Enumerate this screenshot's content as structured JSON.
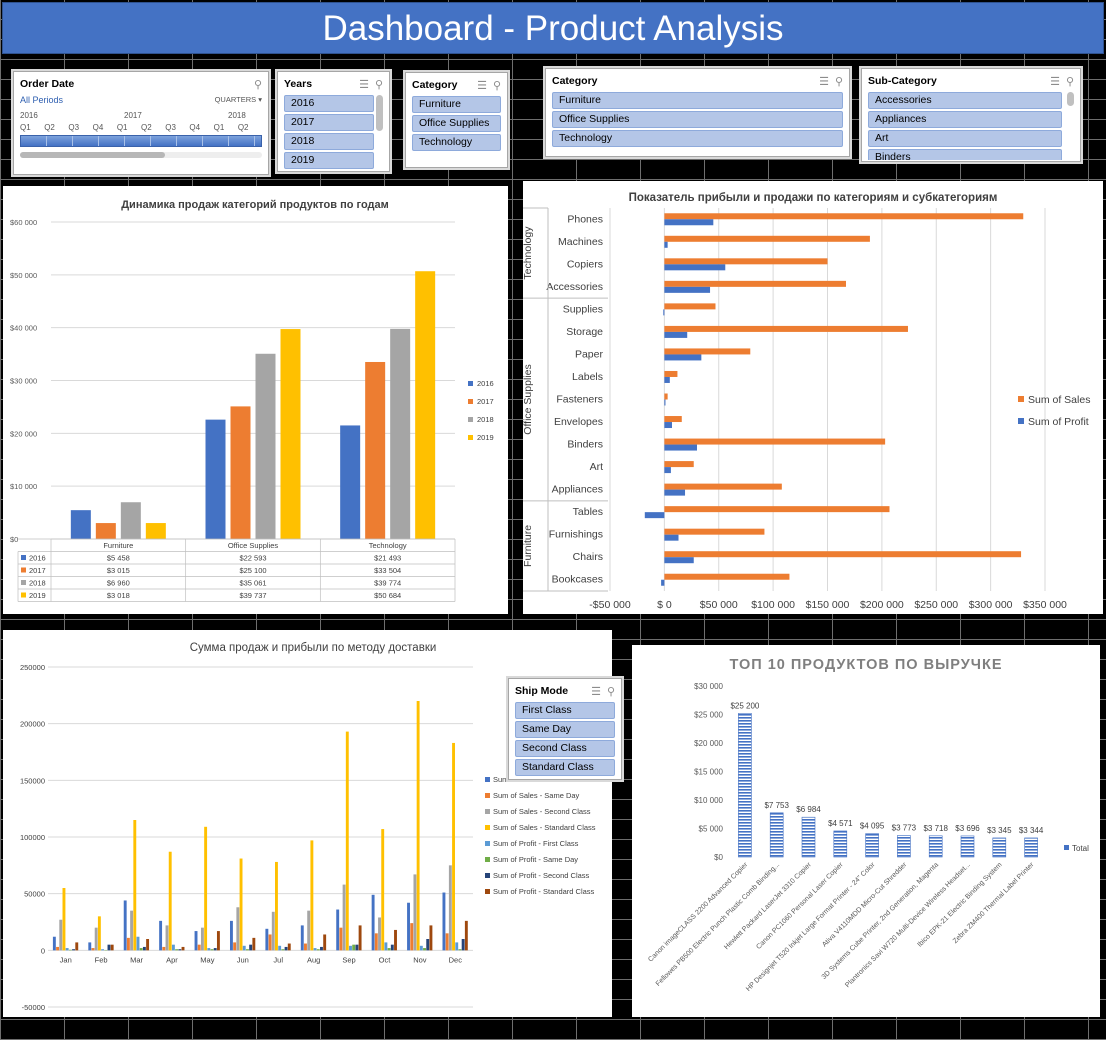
{
  "header": {
    "title": "Dashboard - Product Analysis"
  },
  "colors": {
    "accent": "#4472c4",
    "c2016": "#4472c4",
    "c2017": "#ed7d31",
    "c2018": "#a5a5a5",
    "c2019": "#ffc000",
    "sales": "#ed7d31",
    "profit": "#4472c4"
  },
  "icons": {
    "multiselect": "multiselect-icon",
    "clear_filter": "clear-filter-icon"
  },
  "slicers": {
    "order_date": {
      "title": "Order Date",
      "all_periods": "All Periods",
      "level": "QUARTERS",
      "years": [
        "2016",
        "2017",
        "2018"
      ],
      "quarters": [
        "Q1",
        "Q2",
        "Q3",
        "Q4",
        "Q1",
        "Q2",
        "Q3",
        "Q4",
        "Q1",
        "Q2"
      ]
    },
    "years": {
      "title": "Years",
      "items": [
        "2016",
        "2017",
        "2018",
        "2019"
      ]
    },
    "category_small": {
      "title": "Category",
      "items": [
        "Furniture",
        "Office Supplies",
        "Technology"
      ]
    },
    "category": {
      "title": "Category",
      "items": [
        "Furniture",
        "Office Supplies",
        "Technology"
      ]
    },
    "subcategory": {
      "title": "Sub-Category",
      "items": [
        "Accessories",
        "Appliances",
        "Art",
        "Binders"
      ]
    },
    "ship_mode": {
      "title": "Ship Mode",
      "items": [
        "First Class",
        "Same Day",
        "Second Class",
        "Standard Class"
      ]
    }
  },
  "chart_data": [
    {
      "type": "bar",
      "title": "Динамика продаж категорий продуктов по годам",
      "categories": [
        "Furniture",
        "Office Supplies",
        "Technology"
      ],
      "series": [
        {
          "name": "2016",
          "values": [
            5458,
            22593,
            21493
          ],
          "labels": [
            "$5 458",
            "$22 593",
            "$21 493"
          ]
        },
        {
          "name": "2017",
          "values": [
            3015,
            25100,
            33504
          ],
          "labels": [
            "$3 015",
            "$25 100",
            "$33 504"
          ]
        },
        {
          "name": "2018",
          "values": [
            6960,
            35061,
            39774
          ],
          "labels": [
            "$6 960",
            "$35 061",
            "$39 774"
          ]
        },
        {
          "name": "2019",
          "values": [
            3018,
            39737,
            50684
          ],
          "labels": [
            "$3 018",
            "$39 737",
            "$50 684"
          ]
        }
      ],
      "ylim": [
        0,
        60000
      ],
      "yticks": [
        "$0",
        "$10 000",
        "$20 000",
        "$30 000",
        "$40 000",
        "$50 000",
        "$60 000"
      ],
      "legend": "right",
      "data_table": true
    },
    {
      "type": "bar",
      "orientation": "horizontal",
      "title": "Показатель прибыли и продажи по категориям и субкатегориям",
      "groups": [
        {
          "name": "Technology",
          "items": [
            "Phones",
            "Machines",
            "Copiers",
            "Accessories"
          ]
        },
        {
          "name": "Office Supplies",
          "items": [
            "Supplies",
            "Storage",
            "Paper",
            "Labels",
            "Fasteners",
            "Envelopes",
            "Binders",
            "Art",
            "Appliances"
          ]
        },
        {
          "name": "Furniture",
          "items": [
            "Tables",
            "Furnishings",
            "Chairs",
            "Bookcases"
          ]
        }
      ],
      "series": [
        {
          "name": "Sum of Sales",
          "values": [
            330000,
            189000,
            150000,
            167000,
            47000,
            224000,
            79000,
            12000,
            3000,
            16000,
            203000,
            27000,
            108000,
            207000,
            92000,
            328000,
            115000
          ]
        },
        {
          "name": "Sum of Profit",
          "values": [
            45000,
            3000,
            56000,
            42000,
            -1000,
            21000,
            34000,
            5000,
            1000,
            7000,
            30000,
            6000,
            19000,
            -18000,
            13000,
            27000,
            -3000
          ]
        }
      ],
      "xlim": [
        -50000,
        350000
      ],
      "xticks": [
        "-$50 000",
        "$ 0",
        "$50 000",
        "$100 000",
        "$150 000",
        "$200 000",
        "$250 000",
        "$300 000",
        "$350 000"
      ],
      "legend": "right",
      "legend_order": [
        "Sum of Sales",
        "Sum of Profit"
      ]
    },
    {
      "type": "bar",
      "title": "Сумма  продаж и прибыли по методу доставки",
      "categories": [
        "Jan",
        "Feb",
        "Mar",
        "Apr",
        "May",
        "Jun",
        "Jul",
        "Aug",
        "Sep",
        "Oct",
        "Nov",
        "Dec"
      ],
      "series": [
        {
          "name": "Sum of Sales - First Class",
          "values": [
            12000,
            7000,
            44000,
            26000,
            17000,
            26000,
            19000,
            22000,
            36000,
            49000,
            42000,
            51000
          ]
        },
        {
          "name": "Sum of Sales - Same Day",
          "values": [
            3000,
            2000,
            11000,
            3000,
            5000,
            7000,
            14000,
            6000,
            20000,
            15000,
            24000,
            15000
          ]
        },
        {
          "name": "Sum of Sales - Second Class",
          "values": [
            27000,
            20000,
            35000,
            22000,
            20000,
            38000,
            34000,
            35000,
            58000,
            29000,
            67000,
            75000
          ]
        },
        {
          "name": "Sum of Sales - Standard Class",
          "values": [
            55000,
            30000,
            115000,
            87000,
            109000,
            81000,
            78000,
            97000,
            193000,
            107000,
            220000,
            183000
          ]
        },
        {
          "name": "Sum of Profit - First Class",
          "values": [
            2000,
            1000,
            12000,
            5000,
            2000,
            4000,
            4000,
            2000,
            4000,
            7000,
            4000,
            7000
          ]
        },
        {
          "name": "Sum of Profit - Same Day",
          "values": [
            500,
            300,
            2000,
            1000,
            1000,
            1000,
            1000,
            1000,
            5000,
            2000,
            2000,
            1000
          ]
        },
        {
          "name": "Sum of Profit - Second Class",
          "values": [
            1000,
            5000,
            3000,
            1000,
            2000,
            5000,
            3000,
            3000,
            5000,
            5000,
            10000,
            10000
          ]
        },
        {
          "name": "Sum of Profit - Standard Class",
          "values": [
            7000,
            5000,
            10000,
            3000,
            17000,
            11000,
            6000,
            14000,
            22000,
            18000,
            22000,
            26000
          ]
        }
      ],
      "ylim": [
        -50000,
        250000
      ],
      "yticks": [
        "-50000",
        "0",
        "50000",
        "100000",
        "150000",
        "200000",
        "250000"
      ],
      "legend": "right",
      "legend_first_label": "Sum"
    },
    {
      "type": "bar",
      "title": "ТОП 10 ПРОДУКТОВ ПО ВЫРУЧКЕ",
      "categories": [
        "Canon imageCLASS 2200 Advanced Copier",
        "Fellowes PB500 Electric Punch Plastic Comb Binding...",
        "Hewlett Packard LaserJet 3310 Copier",
        "Canon PC1060 Personal Laser Copier",
        "HP Designjet T520 Inkjet Large Format Printer - 24\" Color",
        "Ativa V4110MDD Micro-Cut Shredder",
        "3D Systems Cube Printer, 2nd Generation, Magenta",
        "Plantronics Savi W720 Multi-Device Wireless Headset...",
        "Ibico EPK-21 Electric Binding System",
        "Zebra ZM400 Thermal Label Printer"
      ],
      "values": [
        25200,
        7753,
        6984,
        4571,
        4095,
        3773,
        3718,
        3696,
        3345,
        3344
      ],
      "labels": [
        "$25 200",
        "$7 753",
        "$6 984",
        "$4 571",
        "$4 095",
        "$3 773",
        "$3 718",
        "$3 696",
        "$3 345",
        "$3 344"
      ],
      "series_name": "Total",
      "ylim": [
        0,
        30000
      ],
      "yticks": [
        "$0",
        "$5 000",
        "$10 000",
        "$15 000",
        "$20 000",
        "$25 000",
        "$30 000"
      ],
      "legend": "right"
    }
  ]
}
